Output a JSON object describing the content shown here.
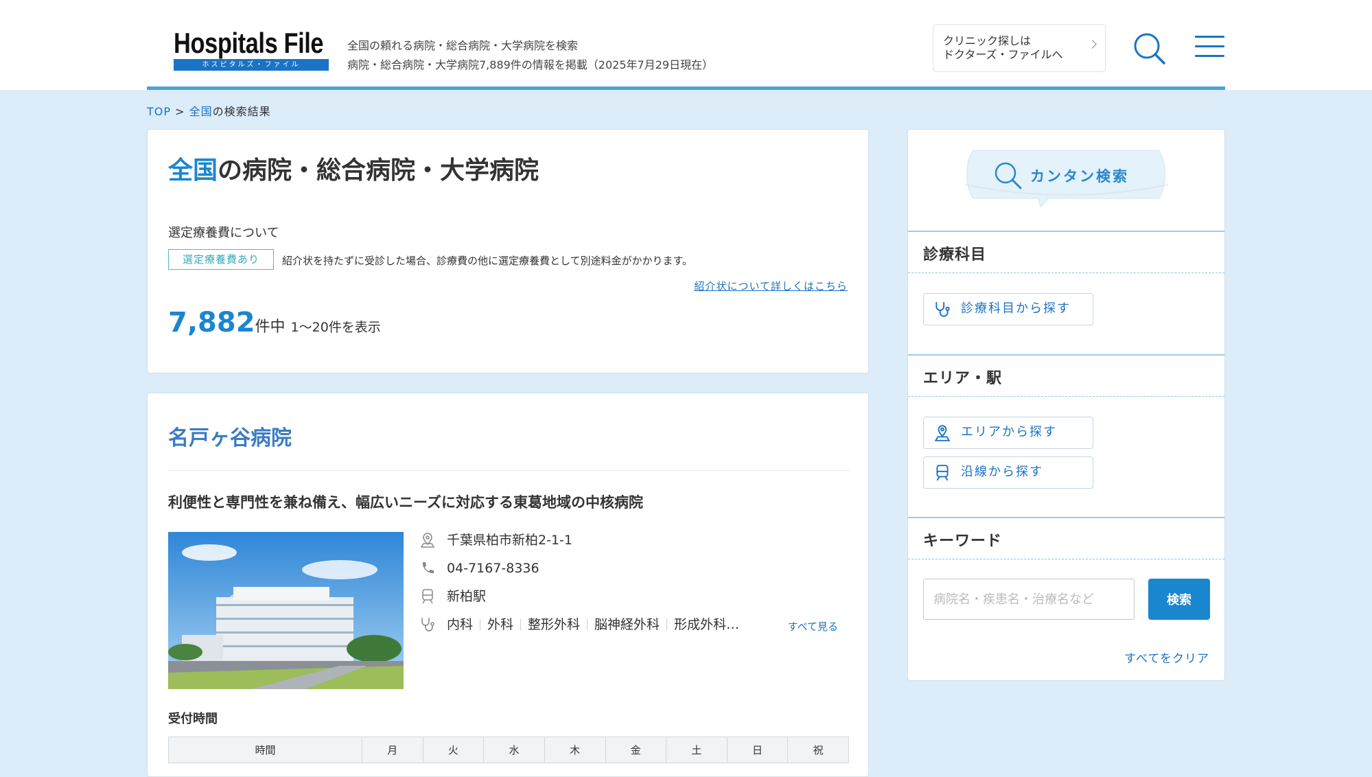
{
  "header": {
    "logo_main": "Hospitals File",
    "logo_sub": "ホスピタルズ・ファイル",
    "tagline_1": "全国の頼れる病院・総合病院・大学病院を検索",
    "tagline_2": "病院・総合病院・大学病院7,889件の情報を掲載（2025年7月29日現在）",
    "clinic_link_1": "クリニック探しは",
    "clinic_link_2": "ドクターズ・ファイルへ"
  },
  "breadcrumb": {
    "top": "TOP",
    "sep": " > ",
    "area": "全国",
    "suffix": "の検索結果"
  },
  "summary": {
    "title_highlight": "全国",
    "title_rest": "の病院・総合病院・大学病院",
    "fee_heading": "選定療養費について",
    "fee_badge": "選定療養費あり",
    "fee_desc": "紹介状を持たずに受診した場合、診療費の他に選定療養費として別途料金がかかります。",
    "fee_link": "紹介状について詳しくはこちら",
    "count": "7,882",
    "count_unit": "件中",
    "range": "1〜20件を表示"
  },
  "hospital": {
    "name": "名戸ヶ谷病院",
    "catch": "利便性と専門性を兼ね備え、幅広いニーズに対応する東葛地域の中核病院",
    "address": "千葉県柏市新柏2-1-1",
    "phone": "04-7167-8336",
    "station": "新柏駅",
    "departments": [
      "内科",
      "外科",
      "整形外科",
      "脳神経外科",
      "形成外科…"
    ],
    "see_all": "すべて見る",
    "hours_label": "受付時間",
    "hours_headers": [
      "時間",
      "月",
      "火",
      "水",
      "木",
      "金",
      "土",
      "日",
      "祝"
    ]
  },
  "sidebar": {
    "easy_search": "カンタン検索",
    "dept_title": "診療科目",
    "dept_button": "診療科目から探す",
    "area_title": "エリア・駅",
    "area_button": "エリアから探す",
    "line_button": "沿線から探す",
    "keyword_title": "キーワード",
    "keyword_placeholder": "病院名・疾患名・治療名など",
    "search_button": "検索",
    "clear_link": "すべてをクリア"
  },
  "colors": {
    "accent": "#1a86d0",
    "link": "#1a73c4",
    "background": "#dcecf8",
    "badge": "#52b6c4"
  }
}
